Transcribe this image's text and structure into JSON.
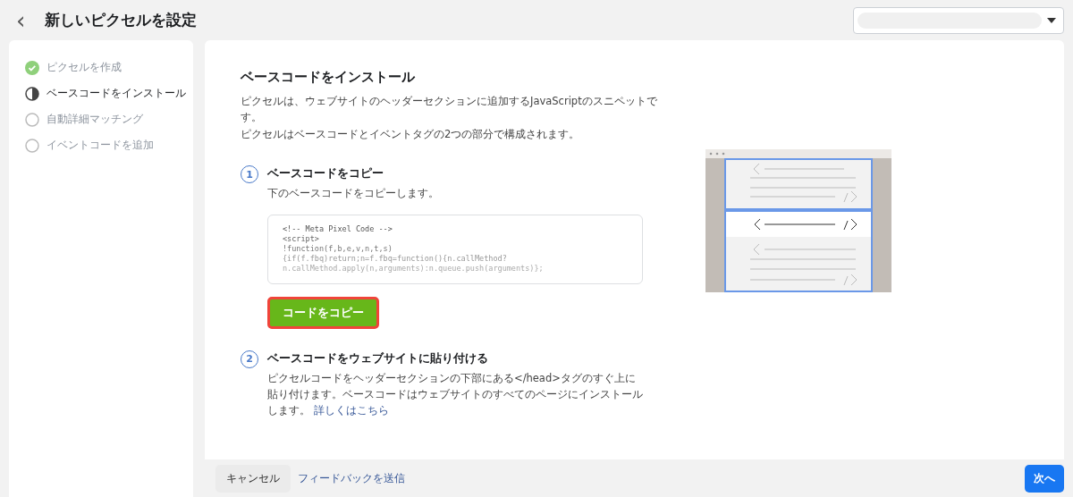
{
  "header": {
    "back": "‹",
    "title": "新しいピクセルを設定"
  },
  "steps": [
    {
      "label": "ピクセルを作成",
      "kind": "done"
    },
    {
      "label": "ベースコードをインストール",
      "kind": "current"
    },
    {
      "label": "自動詳細マッチング",
      "kind": "todo"
    },
    {
      "label": "イベントコードを追加",
      "kind": "todo"
    }
  ],
  "main": {
    "title": "ベースコードをインストール",
    "intro": [
      "ピクセルは、ウェブサイトのヘッダーセクションに追加するJavaScriptのスニペットです。",
      "ピクセルはベースコードとイベントタグの2つの部分で構成されます。"
    ],
    "sections": [
      {
        "number": "1",
        "title": "ベースコードをコピー",
        "text": "下のベースコードをコピーします。",
        "code": [
          "<!-- Meta Pixel Code -->",
          "<script>",
          "!function(f,b,e,v,n,t,s)",
          "{if(f.fbq)return;n=f.fbq=function(){n.callMethod?",
          "n.callMethod.apply(n,arguments):n.queue.push(arguments)};"
        ],
        "button": "コードをコピー",
        "highlighted": true
      },
      {
        "number": "2",
        "title": "ベースコードをウェブサイトに貼り付ける",
        "text": "ピクセルコードをヘッダーセクションの下部にある</head>タグのすぐ上に貼り付けます。ベースコードはウェブサイトのすべてのページにインストールします。",
        "link": "詳しくはこちら"
      }
    ]
  },
  "footer": {
    "cancel": "キャンセル",
    "feedback": "フィードバックを送信",
    "next": "次へ"
  }
}
